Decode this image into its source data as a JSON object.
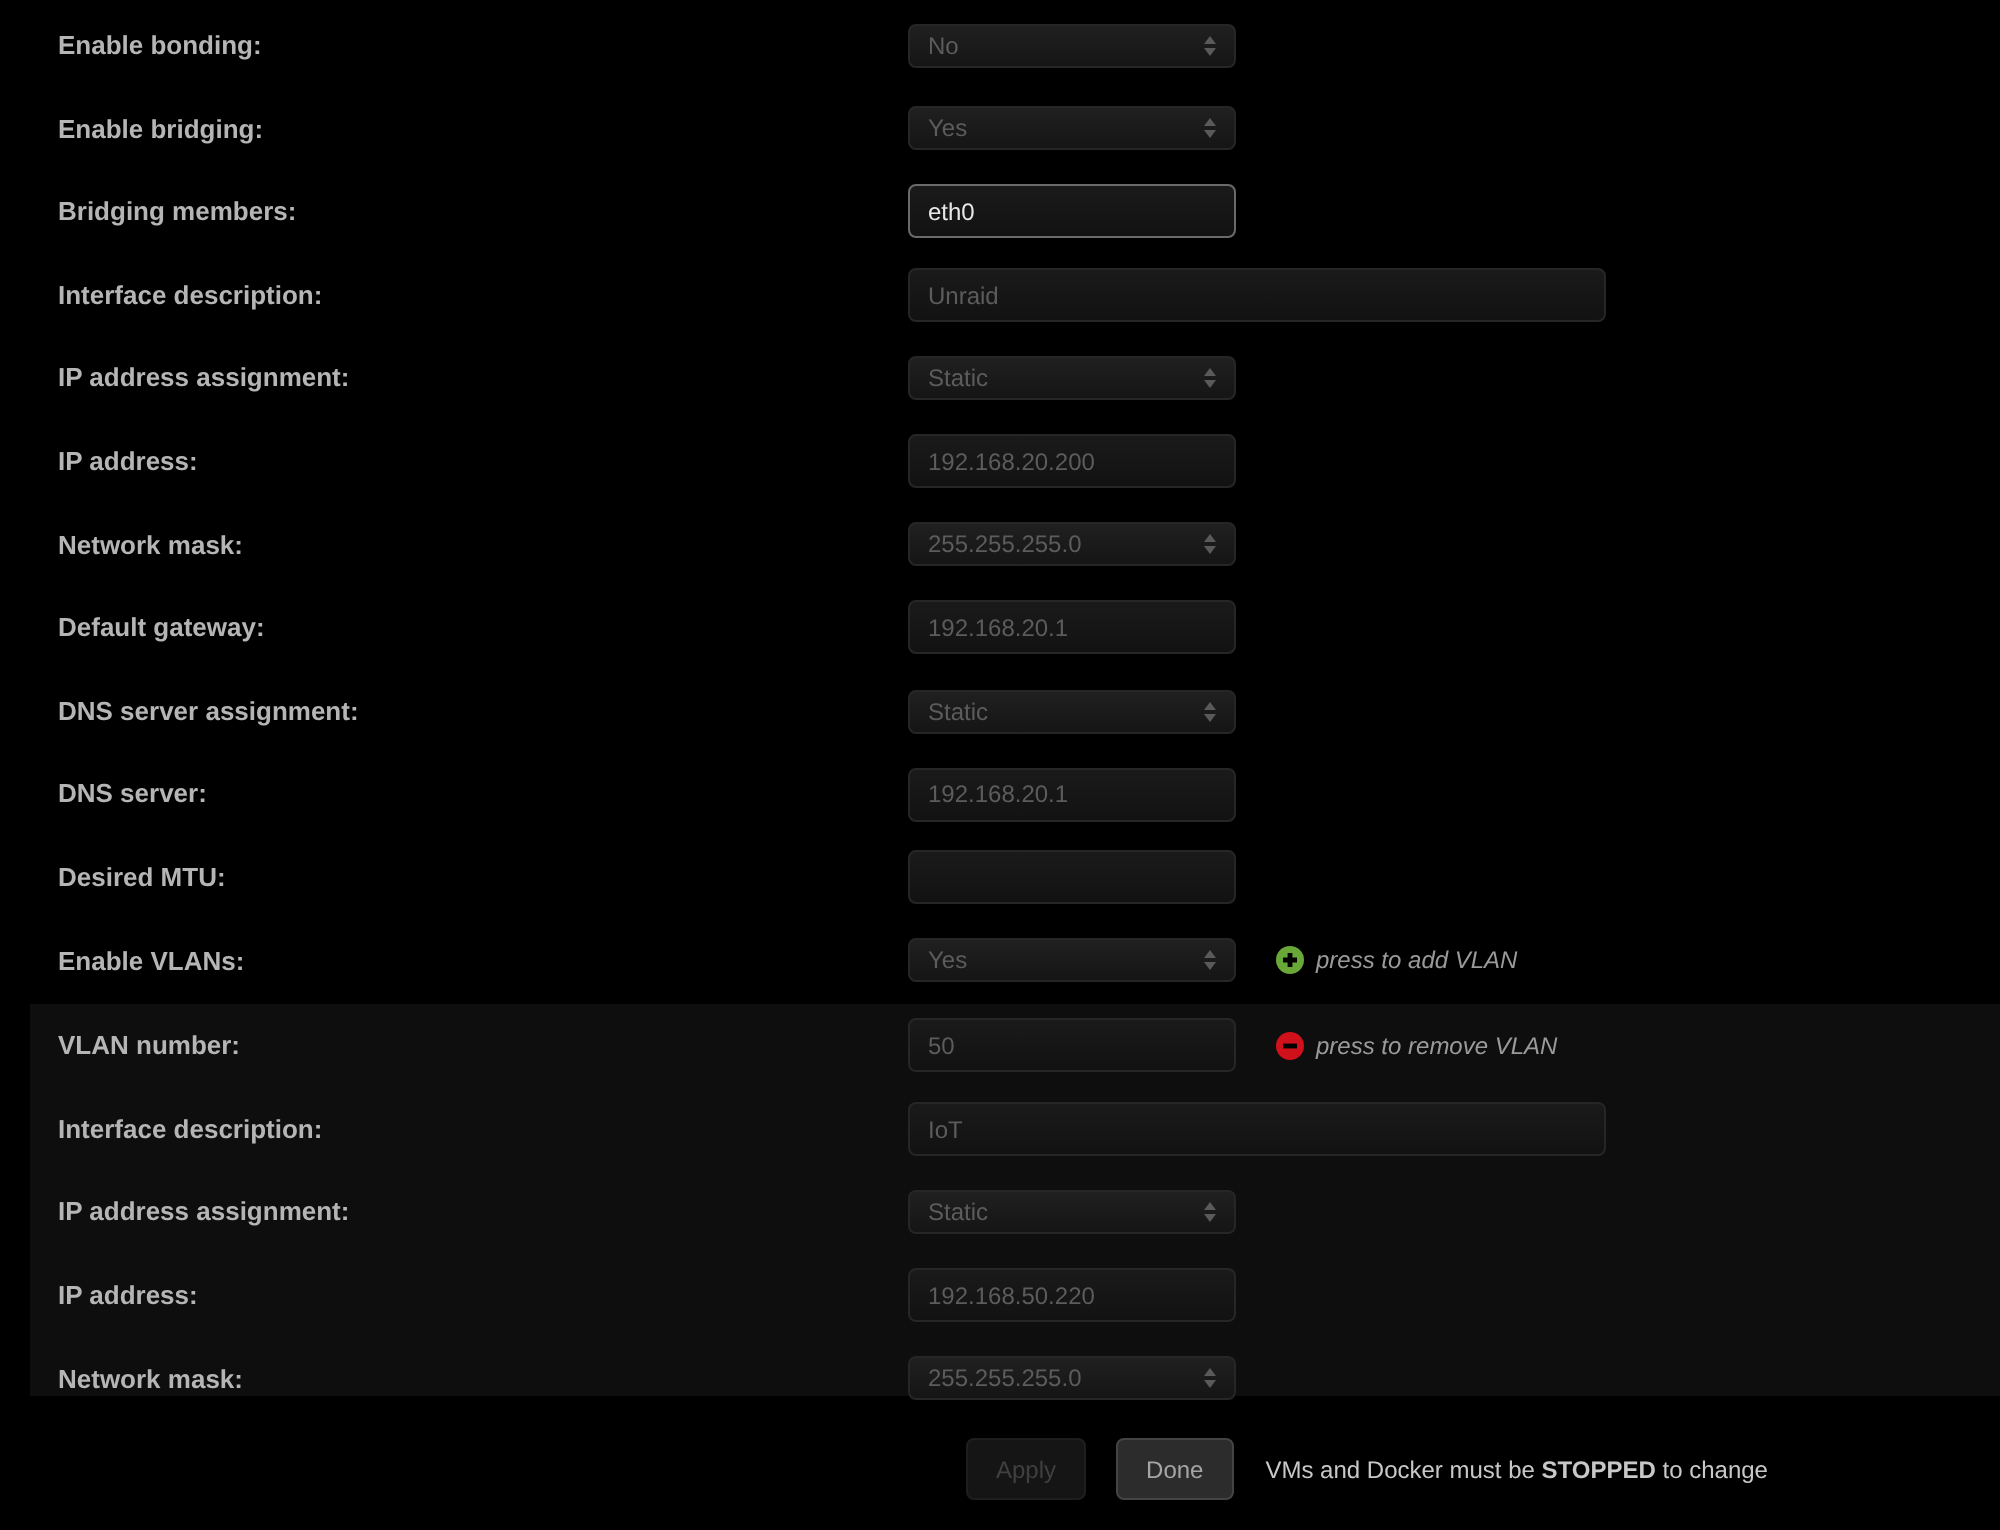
{
  "fields": [
    {
      "label": "Enable bonding:",
      "kind": "select",
      "value": "No",
      "disabled": true
    },
    {
      "label": "Enable bridging:",
      "kind": "select",
      "value": "Yes",
      "disabled": true
    },
    {
      "label": "Bridging members:",
      "kind": "input",
      "value": "eth0",
      "disabled": false
    },
    {
      "label": "Interface description:",
      "kind": "wide",
      "value": "Unraid",
      "disabled": true
    },
    {
      "label": "IP address assignment:",
      "kind": "select",
      "value": "Static",
      "disabled": true
    },
    {
      "label": "IP address:",
      "kind": "input",
      "value": "192.168.20.200",
      "disabled": true
    },
    {
      "label": "Network mask:",
      "kind": "select",
      "value": "255.255.255.0",
      "disabled": true
    },
    {
      "label": "Default gateway:",
      "kind": "input",
      "value": "192.168.20.1",
      "disabled": true
    },
    {
      "label": "DNS server assignment:",
      "kind": "select",
      "value": "Static",
      "disabled": true
    },
    {
      "label": "DNS server:",
      "kind": "input",
      "value": "192.168.20.1",
      "disabled": true
    },
    {
      "label": "Desired MTU:",
      "kind": "input",
      "disabled": true
    },
    {
      "label": "Enable VLANs:",
      "kind": "select",
      "value": "Yes",
      "disabled": true,
      "action": {
        "kind": "add",
        "label": "press to add VLAN"
      }
    }
  ],
  "vlan": {
    "fields": [
      {
        "label": "VLAN number:",
        "kind": "input",
        "value": "50",
        "disabled": true,
        "action": {
          "kind": "remove",
          "label": "press to remove VLAN"
        }
      },
      {
        "label": "Interface description:",
        "kind": "wide",
        "value": "IoT",
        "disabled": true
      },
      {
        "label": "IP address assignment:",
        "kind": "select",
        "value": "Static",
        "disabled": true
      },
      {
        "label": "IP address:",
        "kind": "input",
        "value": "192.168.50.220",
        "disabled": true
      },
      {
        "label": "Network mask:",
        "kind": "select",
        "value": "255.255.255.0",
        "disabled": true
      }
    ]
  },
  "buttons": [
    {
      "label": "Apply",
      "disabled": true
    },
    {
      "label": "Done",
      "disabled": false
    }
  ],
  "note": "VMs and Docker must be **STOPPED** to change"
}
